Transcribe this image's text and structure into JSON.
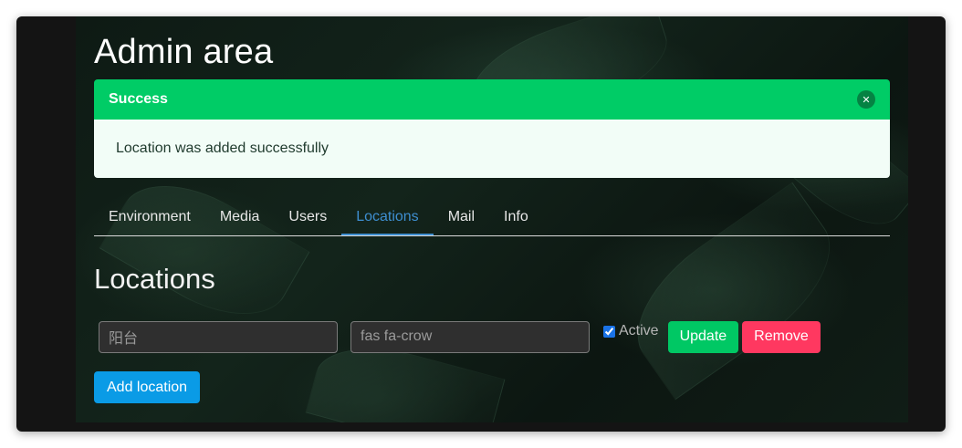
{
  "page": {
    "title": "Admin area"
  },
  "notification": {
    "title": "Success",
    "message": "Location was added successfully",
    "close_icon": "close-icon"
  },
  "tabs": [
    {
      "label": "Environment",
      "active": false
    },
    {
      "label": "Media",
      "active": false
    },
    {
      "label": "Users",
      "active": false
    },
    {
      "label": "Locations",
      "active": true
    },
    {
      "label": "Mail",
      "active": false
    },
    {
      "label": "Info",
      "active": false
    }
  ],
  "locations": {
    "section_title": "Locations",
    "rows": [
      {
        "name_value": "阳台",
        "icon_value": "fas fa-crow",
        "active_label": "Active",
        "active_checked": true,
        "update_label": "Update",
        "remove_label": "Remove"
      }
    ],
    "add_label": "Add location"
  },
  "colors": {
    "success": "#00cc66",
    "tab_active": "#3e8ed0",
    "update_button": "#00c864",
    "remove_button": "#ff3860",
    "add_button": "#0a9be6"
  }
}
